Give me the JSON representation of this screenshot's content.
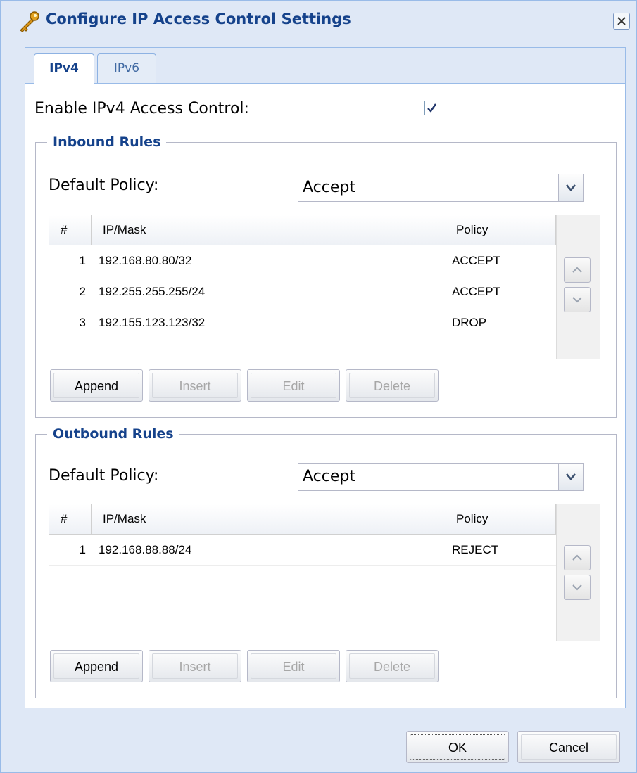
{
  "window": {
    "title": "Configure IP Access Control Settings",
    "icon": "key-icon",
    "close_icon": "close-icon"
  },
  "tabs": [
    {
      "label": "IPv4",
      "active": true
    },
    {
      "label": "IPv6",
      "active": false
    }
  ],
  "enable": {
    "label": "Enable IPv4 Access Control:",
    "checked": true
  },
  "inbound": {
    "legend": "Inbound Rules",
    "policy_label": "Default Policy:",
    "policy_value": "Accept",
    "columns": [
      "#",
      "IP/Mask",
      "Policy"
    ],
    "rows": [
      {
        "num": "1",
        "ip": "192.168.80.80/32",
        "policy": "ACCEPT"
      },
      {
        "num": "2",
        "ip": "192.255.255.255/24",
        "policy": "ACCEPT"
      },
      {
        "num": "3",
        "ip": "192.155.123.123/32",
        "policy": "DROP"
      }
    ],
    "buttons": {
      "append": "Append",
      "insert": "Insert",
      "edit": "Edit",
      "delete": "Delete"
    }
  },
  "outbound": {
    "legend": "Outbound Rules",
    "policy_label": "Default Policy:",
    "policy_value": "Accept",
    "columns": [
      "#",
      "IP/Mask",
      "Policy"
    ],
    "rows": [
      {
        "num": "1",
        "ip": "192.168.88.88/24",
        "policy": "REJECT"
      }
    ],
    "buttons": {
      "append": "Append",
      "insert": "Insert",
      "edit": "Edit",
      "delete": "Delete"
    }
  },
  "footer": {
    "ok": "OK",
    "cancel": "Cancel"
  },
  "colors": {
    "title_text": "#15428b",
    "frame": "#dfe8f6",
    "border": "#99bbe8",
    "disabled_text": "#a7a7a7"
  }
}
